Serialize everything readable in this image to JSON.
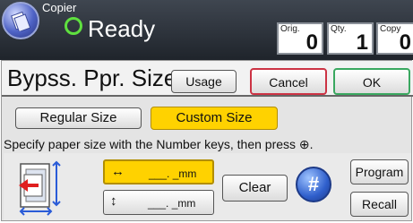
{
  "header": {
    "app_name": "Copier",
    "status": "Ready",
    "counters": [
      {
        "label": "Orig.",
        "value": "0"
      },
      {
        "label": "Qty.",
        "value": "1"
      },
      {
        "label": "Copy",
        "value": "0"
      }
    ]
  },
  "panel": {
    "title": "Bypss. Ppr. Size",
    "usage_label": "Usage",
    "cancel_label": "Cancel",
    "ok_label": "OK"
  },
  "size_tabs": {
    "regular_label": "Regular Size",
    "custom_label": "Custom Size",
    "selected": "Custom Size"
  },
  "instruction": "Specify paper size with the Number keys, then press ⊕.",
  "fields": {
    "horizontal": {
      "arrow": "↔",
      "value": "___. _mm"
    },
    "vertical": {
      "arrow": "↕",
      "value": "___. _mm"
    }
  },
  "keys": {
    "clear_label": "Clear",
    "hash_label": "#",
    "program_label": "Program",
    "recall_label": "Recall"
  },
  "colors": {
    "selected": "#ffd200",
    "cancel_border": "#cc3344",
    "ok_border": "#3aa860",
    "status_indicator": "#5fe03f"
  }
}
